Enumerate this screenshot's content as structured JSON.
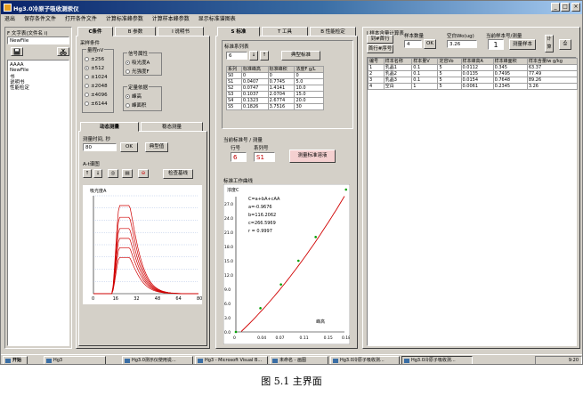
{
  "window": {
    "title": "Hg3.0冷原子吸收测汞仪",
    "minimize": "_",
    "maximize": "□",
    "close": "×"
  },
  "menu": [
    "退出",
    "保存条件文件",
    "打开条件文件",
    "计算标准峰参数",
    "计算样本峰参数",
    "显示标准谱图表"
  ],
  "sidebar": {
    "title": "F 文字表(文件名 i)",
    "input_value": "NewFile",
    "items": [
      "AAAA",
      "NewFile",
      "书",
      "说明书",
      "性能检定"
    ]
  },
  "left_tabs": [
    "C条件",
    "B 参数",
    "I 说明书"
  ],
  "conditions": {
    "group_title": "采样条件",
    "range_title": "量程nV",
    "ranges": [
      "±256",
      "±512",
      "±1024",
      "±2048",
      "±4096",
      "±6144"
    ],
    "range_selected": 1,
    "signal_title": "信号属性",
    "signals": [
      "吸光度A",
      "光强度F"
    ],
    "signal_selected": 0,
    "quant_title": "定量依据",
    "quants": [
      "峰高",
      "峰面积"
    ],
    "quant_selected": 0
  },
  "measure_tabs": [
    "动态测量",
    "稳态测量"
  ],
  "measure": {
    "time_label": "测量时间, 秒",
    "time_value": "80",
    "ok_label": "OK",
    "typical_label": "典型值",
    "at_label": "A-t谱图",
    "check_baseline": "检查基线",
    "plot_ylabel": "吸光度A",
    "plot_xticks": [
      "0",
      "16",
      "32",
      "48",
      "64",
      "80"
    ]
  },
  "mid_tabs": [
    "S 标准",
    "T 工具",
    "B 性能检定"
  ],
  "standards": {
    "title": "标准系列表",
    "count_value": "6",
    "typical_label": "典型标准",
    "columns": [
      "系列",
      "标准峰高",
      "标准峰积",
      "浓度F g/L"
    ],
    "rows": [
      [
        "S0",
        "0",
        "0",
        "0"
      ],
      [
        "S1",
        "0.0407",
        "0.7745",
        "5.0"
      ],
      [
        "S2",
        "0.0747",
        "1.4141",
        "10.0"
      ],
      [
        "S3",
        "0.1037",
        "2.0704",
        "15.0"
      ],
      [
        "S4",
        "0.1323",
        "2.6774",
        "20.0"
      ],
      [
        "S5",
        "0.1826",
        "3.7516",
        "30"
      ]
    ]
  },
  "current_std": {
    "title": "当前标准号 / 测量",
    "row_label": "行号",
    "series_label": "系列号",
    "row_value": "6",
    "series_value": "S1",
    "measure_btn": "测量标准溶液"
  },
  "curve": {
    "title": "标准工作曲线",
    "ylabel": "浓度C",
    "formula": "C=a+bA+cAA",
    "a": "a=-0.9676",
    "b": "b=116.2062",
    "c": "c=266.5969",
    "r": "r = 0.9997",
    "xlabel": "峰高",
    "xticks": [
      "0",
      "0.04",
      "0.07",
      "0.11",
      "0.15",
      "0.18"
    ],
    "yticks": [
      "27.0",
      "24.0",
      "21.0",
      "18.0",
      "15.0",
      "12.0",
      "9.0",
      "6.0",
      "3.0",
      "0.0"
    ]
  },
  "samples": {
    "title": "I 样本含量计算表",
    "to_first": "到#首行",
    "first_to_num": "首行#序号",
    "count_label": "样本数量",
    "count_value": "4",
    "ok_label": "OK",
    "blank_label": "空白Wo(ug)",
    "blank_value": "3.26",
    "current_label": "当前样本号/测量",
    "current_value": "1",
    "measure_btn": "测量样本",
    "calc_btn": "计算",
    "columns": [
      "编号",
      "样本名称",
      "样本量V",
      "定容Vo",
      "样本峰高A",
      "样本峰面积",
      "样本含量Iw g/kg"
    ],
    "rows": [
      [
        "1",
        "乳晶1",
        "0.1",
        "5",
        "0.0112",
        "0.345",
        "63.37"
      ],
      [
        "2",
        "乳晶2",
        "0.1",
        "5",
        "0.0135",
        "0.7495",
        "77.49"
      ],
      [
        "3",
        "乳晶3",
        "0.1",
        "5",
        "0.0154",
        "0.7648",
        "89.26"
      ],
      [
        "4",
        "空白",
        "1",
        "5",
        "0.0061",
        "0.2345",
        "3.26"
      ]
    ]
  },
  "taskbar": {
    "start": "开始",
    "items": [
      "Hg3",
      "Hg3.0测示仪使用说...",
      "Hg3 - Microsoft Visual B...",
      "未命名 - 画图",
      "Hg3.0冷原子吸收测...",
      "Hg3.0冷原子吸收测..."
    ],
    "clock": "9:20"
  },
  "figure_caption": "图 5.1    主界面",
  "peak_heights": [
    0.18,
    0.156,
    0.133,
    0.113,
    0.094,
    0.074
  ],
  "calibration_points": [
    [
      0,
      0
    ],
    [
      0.0407,
      5.0
    ],
    [
      0.0747,
      10.0
    ],
    [
      0.1037,
      15.0
    ],
    [
      0.1323,
      20.0
    ],
    [
      0.1826,
      30
    ]
  ]
}
